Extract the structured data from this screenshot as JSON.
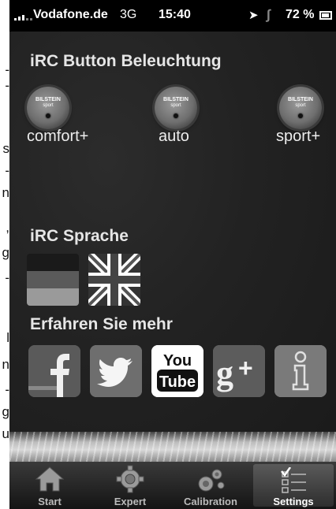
{
  "left_edge_fragments": [
    {
      "text": "-",
      "top": 0
    },
    {
      "text": "-",
      "top": 0
    },
    {
      "text": "s",
      "top": 0
    },
    {
      "text": "-",
      "top": 0
    },
    {
      "text": "n",
      "top": 0
    },
    {
      "text": ",",
      "top": 0
    },
    {
      "text": "g",
      "top": 0
    },
    {
      "text": "-",
      "top": 0
    },
    {
      "text": "l",
      "top": 0
    },
    {
      "text": "n",
      "top": 0
    },
    {
      "text": "-",
      "top": 0
    },
    {
      "text": "g",
      "top": 0
    },
    {
      "text": "u",
      "top": 0
    }
  ],
  "status_bar": {
    "carrier": "Vodafone.de",
    "network": "3G",
    "time": "15:40",
    "battery": "72 %",
    "icons": [
      "signal-icon",
      "location-arrow-icon",
      "bluetooth-icon",
      "battery-icon"
    ]
  },
  "sections": {
    "lighting_title": "iRC Button Beleuchtung",
    "language_title": "iRC Sprache",
    "more_title": "Erfahren Sie mehr"
  },
  "lighting_buttons": [
    {
      "label": "comfort+",
      "brand": "BILSTEIN",
      "sub": "sport"
    },
    {
      "label": "auto",
      "brand": "BILSTEIN",
      "sub": "sport"
    },
    {
      "label": "sport+",
      "brand": "BILSTEIN",
      "sub": "sport"
    }
  ],
  "languages": [
    {
      "icon": "german-flag-icon"
    },
    {
      "icon": "uk-flag-icon"
    }
  ],
  "social_links": [
    {
      "icon": "facebook-icon"
    },
    {
      "icon": "twitter-icon"
    },
    {
      "icon": "youtube-icon",
      "line1": "You",
      "line2": "Tube"
    },
    {
      "icon": "google-plus-icon",
      "text": "g+"
    },
    {
      "icon": "info-icon",
      "text": "i"
    }
  ],
  "tabs": [
    {
      "label": "Start",
      "icon": "home-icon",
      "active": false
    },
    {
      "label": "Expert",
      "icon": "gear-icon",
      "active": false
    },
    {
      "label": "Calibration",
      "icon": "gears-icon",
      "active": false
    },
    {
      "label": "Settings",
      "icon": "checklist-icon",
      "active": true
    }
  ],
  "colors": {
    "facebook": "#5a5a5a",
    "twitter": "#6a6a6a",
    "youtube": "#ffffff",
    "google": "#5c5c5c",
    "info": "#7a7a7a"
  }
}
